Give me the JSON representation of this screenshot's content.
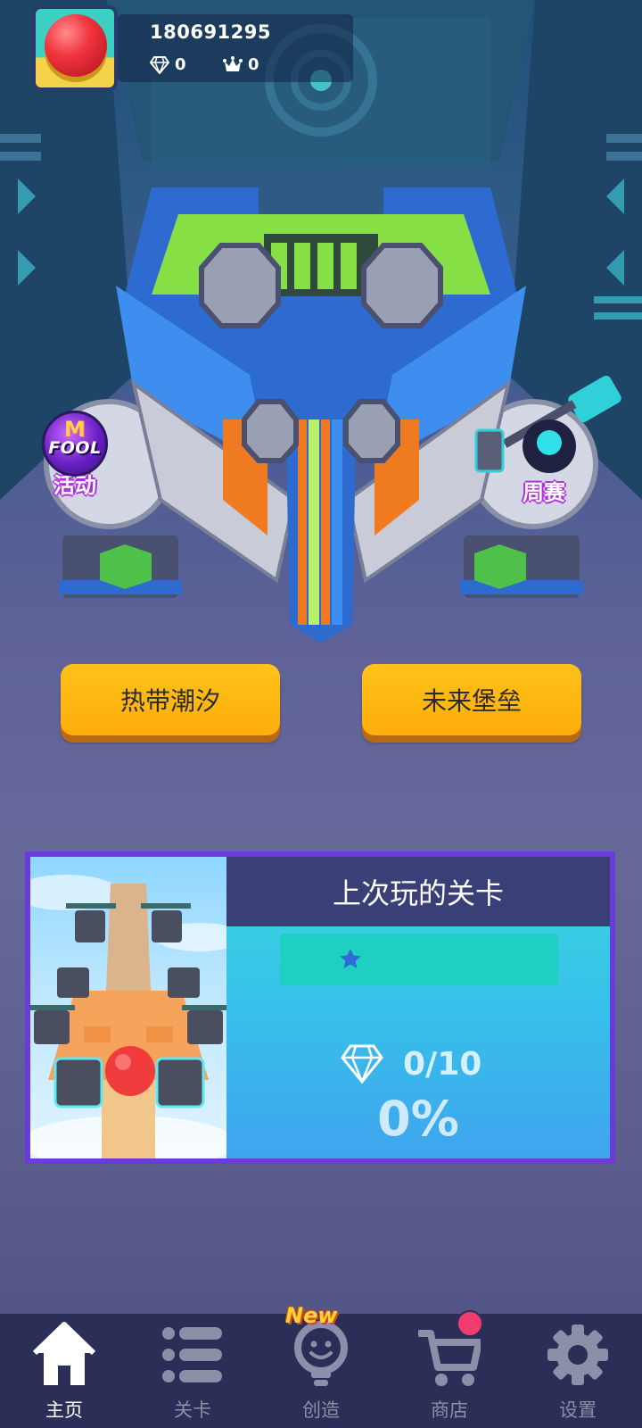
{
  "profile": {
    "user_id": "180691295",
    "gems": "0",
    "crowns": "0",
    "avatar_icon": "red-ball-avatar"
  },
  "side_buttons": {
    "activity": {
      "label": "活动",
      "badge_text": "FOOL",
      "badge_letter": "M"
    },
    "weekly": {
      "label": "周赛"
    }
  },
  "maps": [
    {
      "label": "热带潮汐"
    },
    {
      "label": "未来堡垒"
    }
  ],
  "last_played": {
    "title": "上次玩的关卡",
    "stars": 1,
    "gems_collected": "0/10",
    "progress_text": "0%",
    "progress": 0
  },
  "bottom_nav": {
    "items": [
      {
        "label": "主页",
        "icon": "home-icon",
        "active": true
      },
      {
        "label": "关卡",
        "icon": "list-icon",
        "active": false
      },
      {
        "label": "创造",
        "icon": "lightbulb-icon",
        "active": false,
        "badge": "New"
      },
      {
        "label": "商店",
        "icon": "cart-icon",
        "active": false,
        "notification": true
      },
      {
        "label": "设置",
        "icon": "gear-icon",
        "active": false
      }
    ]
  },
  "colors": {
    "accent_button": "#ffb20f",
    "card_border": "#6a3bd9",
    "nav_background": "#2b2e56",
    "active_nav": "#ffffff",
    "inactive_nav": "#8b8fa8"
  }
}
